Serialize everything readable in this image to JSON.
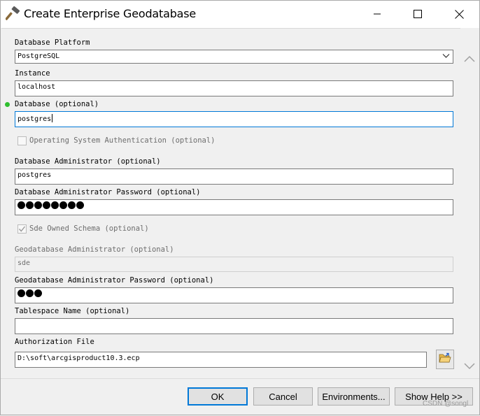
{
  "window": {
    "title": "Create Enterprise Geodatabase",
    "title_icon": "hammer-icon",
    "controls": [
      "minimize-icon",
      "maximize-icon",
      "close-icon"
    ]
  },
  "form": {
    "database_platform": {
      "label": "Database Platform",
      "value": "PostgreSQL"
    },
    "instance": {
      "label": "Instance",
      "value": "localhost"
    },
    "database": {
      "label": "Database (optional)",
      "value": "postgres"
    },
    "os_auth": {
      "label": "Operating System Authentication (optional)",
      "checked": false
    },
    "db_admin": {
      "label": "Database Administrator (optional)",
      "value": "postgres"
    },
    "db_admin_password": {
      "label": "Database Administrator Password (optional)",
      "masked_length": 8
    },
    "sde_owned_schema": {
      "label": "Sde Owned Schema (optional)",
      "checked": true
    },
    "gdb_admin": {
      "label": "Geodatabase Administrator (optional)",
      "value": "sde"
    },
    "gdb_admin_password": {
      "label": "Geodatabase Administrator Password (optional)",
      "masked_length": 3
    },
    "tablespace": {
      "label": "Tablespace Name (optional)",
      "value": ""
    },
    "authorization_file": {
      "label": "Authorization File",
      "value": "D:\\soft\\arcgisproduct10.3.ecp",
      "browse_icon": "folder-open-icon"
    }
  },
  "buttons": {
    "ok": "OK",
    "cancel": "Cancel",
    "environments": "Environments...",
    "show_help": "Show Help >>"
  },
  "watermark": "CSDN @songl",
  "colors": {
    "focus_border": "#0078d7",
    "valid_indicator": "#2fbf2f",
    "title_bar": "#ffffff",
    "dialog_bg": "#f0f0f0"
  }
}
